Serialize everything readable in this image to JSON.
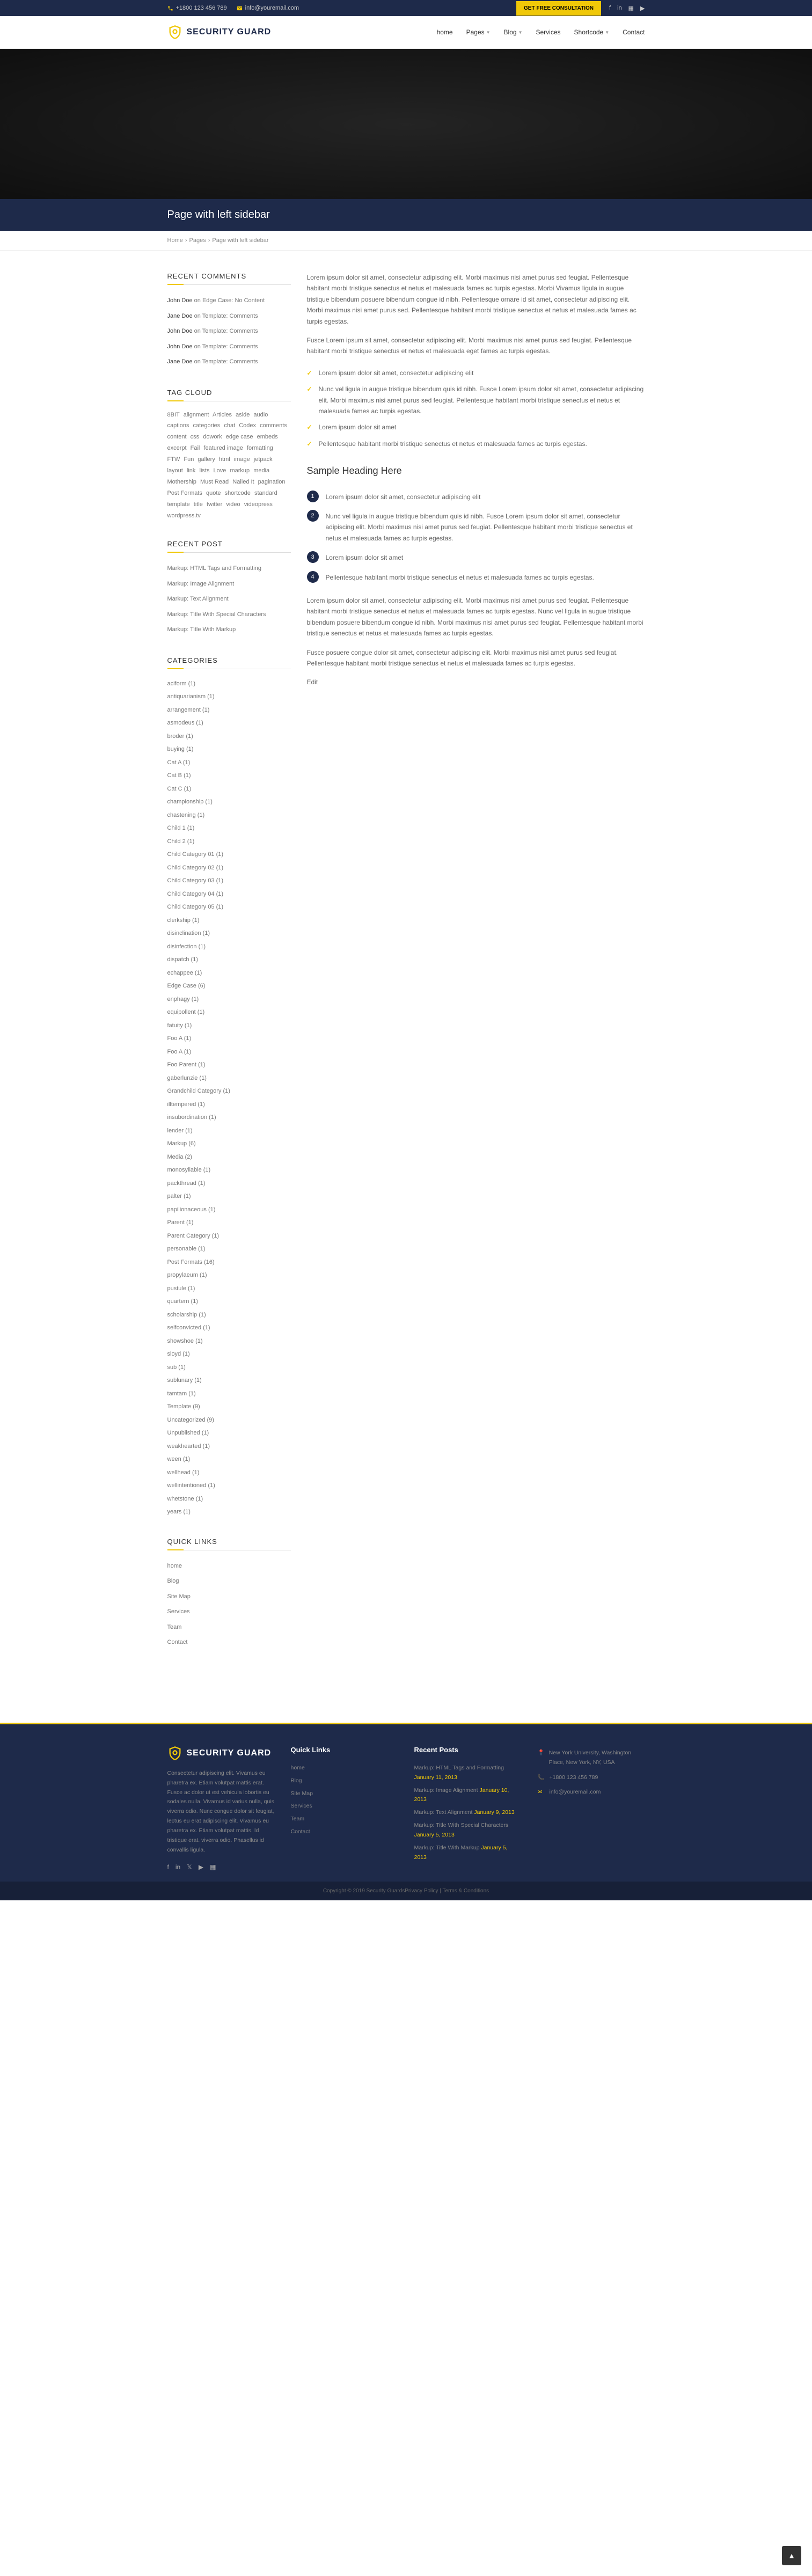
{
  "topbar": {
    "phone": "+1800 123 456 789",
    "email": "info@youremail.com",
    "cta": "GET FREE CONSULTATION"
  },
  "brand": "SECURITY GUARD",
  "nav": [
    "home",
    "Pages",
    "Blog",
    "Services",
    "Shortcode",
    "Contact"
  ],
  "page_title": "Page with left sidebar",
  "breadcrumb": [
    "Home",
    "Pages",
    "Page with left sidebar"
  ],
  "sidebar": {
    "recent_comments_title": "RECENT COMMENTS",
    "comments": [
      {
        "author": "John Doe",
        "on": "Edge Case: No Content"
      },
      {
        "author": "Jane Doe",
        "on": "Template: Comments"
      },
      {
        "author": "John Doe",
        "on": "Template: Comments"
      },
      {
        "author": "John Doe",
        "on": "Template: Comments"
      },
      {
        "author": "Jane Doe",
        "on": "Template: Comments"
      }
    ],
    "tag_title": "TAG CLOUD",
    "tags": [
      "8BIT",
      "alignment",
      "Articles",
      "aside",
      "audio",
      "captions",
      "categories",
      "chat",
      "Codex",
      "comments",
      "content",
      "css",
      "dowork",
      "edge case",
      "embeds",
      "excerpt",
      "Fail",
      "featured image",
      "formatting",
      "FTW",
      "Fun",
      "gallery",
      "html",
      "image",
      "jetpack",
      "layout",
      "link",
      "lists",
      "Love",
      "markup",
      "media",
      "Mothership",
      "Must Read",
      "Nailed It",
      "pagination",
      "Post Formats",
      "quote",
      "shortcode",
      "standard",
      "template",
      "title",
      "twitter",
      "video",
      "videopress",
      "wordpress.tv"
    ],
    "recent_title": "RECENT POST",
    "recent": [
      "Markup: HTML Tags and Formatting",
      "Markup: Image Alignment",
      "Markup: Text Alignment",
      "Markup: Title With Special Characters",
      "Markup: Title With Markup"
    ],
    "cat_title": "CATEGORIES",
    "categories": [
      {
        "n": "aciform",
        "c": 1
      },
      {
        "n": "antiquarianism",
        "c": 1
      },
      {
        "n": "arrangement",
        "c": 1
      },
      {
        "n": "asmodeus",
        "c": 1
      },
      {
        "n": "broder",
        "c": 1
      },
      {
        "n": "buying",
        "c": 1
      },
      {
        "n": "Cat A",
        "c": 1
      },
      {
        "n": "Cat B",
        "c": 1
      },
      {
        "n": "Cat C",
        "c": 1
      },
      {
        "n": "championship",
        "c": 1
      },
      {
        "n": "chastening",
        "c": 1
      },
      {
        "n": "Child 1",
        "c": 1
      },
      {
        "n": "Child 2",
        "c": 1
      },
      {
        "n": "Child Category 01",
        "c": 1
      },
      {
        "n": "Child Category 02",
        "c": 1
      },
      {
        "n": "Child Category 03",
        "c": 1
      },
      {
        "n": "Child Category 04",
        "c": 1
      },
      {
        "n": "Child Category 05",
        "c": 1
      },
      {
        "n": "clerkship",
        "c": 1
      },
      {
        "n": "disinclination",
        "c": 1
      },
      {
        "n": "disinfection",
        "c": 1
      },
      {
        "n": "dispatch",
        "c": 1
      },
      {
        "n": "echappee",
        "c": 1
      },
      {
        "n": "Edge Case",
        "c": 6
      },
      {
        "n": "enphagy",
        "c": 1
      },
      {
        "n": "equipollent",
        "c": 1
      },
      {
        "n": "fatuity",
        "c": 1
      },
      {
        "n": "Foo A",
        "c": 1
      },
      {
        "n": "Foo A",
        "c": 1
      },
      {
        "n": "Foo Parent",
        "c": 1
      },
      {
        "n": "gaberlunzie",
        "c": 1
      },
      {
        "n": "Grandchild Category",
        "c": 1
      },
      {
        "n": "illtempered",
        "c": 1
      },
      {
        "n": "insubordination",
        "c": 1
      },
      {
        "n": "lender",
        "c": 1
      },
      {
        "n": "Markup",
        "c": 6
      },
      {
        "n": "Media",
        "c": 2
      },
      {
        "n": "monosyllable",
        "c": 1
      },
      {
        "n": "packthread",
        "c": 1
      },
      {
        "n": "palter",
        "c": 1
      },
      {
        "n": "papilionaceous",
        "c": 1
      },
      {
        "n": "Parent",
        "c": 1
      },
      {
        "n": "Parent Category",
        "c": 1
      },
      {
        "n": "personable",
        "c": 1
      },
      {
        "n": "Post Formats",
        "c": 16
      },
      {
        "n": "propylaeum",
        "c": 1
      },
      {
        "n": "pustule",
        "c": 1
      },
      {
        "n": "quartern",
        "c": 1
      },
      {
        "n": "scholarship",
        "c": 1
      },
      {
        "n": "selfconvicted",
        "c": 1
      },
      {
        "n": "showshoe",
        "c": 1
      },
      {
        "n": "sloyd",
        "c": 1
      },
      {
        "n": "sub",
        "c": 1
      },
      {
        "n": "sublunary",
        "c": 1
      },
      {
        "n": "tamtam",
        "c": 1
      },
      {
        "n": "Template",
        "c": 9
      },
      {
        "n": "Uncategorized",
        "c": 9
      },
      {
        "n": "Unpublished",
        "c": 1
      },
      {
        "n": "weakhearted",
        "c": 1
      },
      {
        "n": "ween",
        "c": 1
      },
      {
        "n": "wellhead",
        "c": 1
      },
      {
        "n": "wellintentioned",
        "c": 1
      },
      {
        "n": "whetstone",
        "c": 1
      },
      {
        "n": "years",
        "c": 1
      }
    ],
    "quick_title": "QUICK LINKS",
    "quick": [
      "home",
      "Blog",
      "Site Map",
      "Services",
      "Team",
      "Contact"
    ]
  },
  "content": {
    "p1": "Lorem ipsum dolor sit amet, consectetur adipiscing elit. Morbi maximus nisi amet purus sed feugiat. Pellentesque habitant morbi tristique senectus et netus et malesuada fames ac turpis egestas. Morbi Vivamus ligula in augue tristique bibendum posuere bibendum congue id nibh. Pellentesque ornare id sit amet, consectetur adipiscing elit. Morbi maximus nisi amet purus sed. Pellentesque habitant morbi tristique senectus et netus et malesuada fames ac turpis egestas.",
    "p2": "Fusce Lorem ipsum sit amet, consectetur adipiscing elit. Morbi maximus nisi amet purus sed feugiat. Pellentesque habitant morbi tristique senectus et netus et malesuada eget fames ac turpis egestas.",
    "checks": [
      "Lorem ipsum dolor sit amet, consectetur adipiscing elit",
      "Nunc vel ligula in augue tristique bibendum quis id nibh. Fusce Lorem ipsum dolor sit amet, consectetur adipiscing elit. Morbi maximus nisi amet purus sed feugiat. Pellentesque habitant morbi tristique senectus et netus et malesuada fames ac turpis egestas.",
      "Lorem ipsum dolor sit amet",
      "Pellentesque habitant morbi tristique senectus et netus et malesuada fames ac turpis egestas."
    ],
    "h3": "Sample Heading Here",
    "nums": [
      "Lorem ipsum dolor sit amet, consectetur adipiscing elit",
      "Nunc vel ligula in augue tristique bibendum quis id nibh. Fusce Lorem ipsum dolor sit amet, consectetur adipiscing elit. Morbi maximus nisi amet purus sed feugiat. Pellentesque habitant morbi tristique senectus et netus et malesuada fames ac turpis egestas.",
      "Lorem ipsum dolor sit amet",
      "Pellentesque habitant morbi tristique senectus et netus et malesuada fames ac turpis egestas."
    ],
    "p3": "Lorem ipsum dolor sit amet, consectetur adipiscing elit. Morbi maximus nisi amet purus sed feugiat. Pellentesque habitant morbi tristique senectus et netus et malesuada fames ac turpis egestas. Nunc vel ligula in augue tristique bibendum posuere bibendum congue id nibh. Morbi maximus nisi amet purus sed feugiat. Pellentesque habitant morbi tristique senectus et netus et malesuada fames ac turpis egestas.",
    "p4": "Fusce posuere congue dolor sit amet, consectetur adipiscing elit. Morbi maximus nisi amet purus sed feugiat. Pellentesque habitant morbi tristique senectus et netus et malesuada fames ac turpis egestas.",
    "edit": "Edit"
  },
  "footer": {
    "about": "Consectetur adipiscing elit. Vivamus eu pharetra ex. Etiam volutpat mattis erat. Fusce ac dolor ut est vehicula lobortis eu sodales nulla. Vivamus id varius nulla, quis viverra odio. Nunc congue dolor sit feugiat, lectus eu erat adipiscing elit. Vivamus eu pharetra ex. Etiam volutpat mattis. Id tristique erat. viverra odio. Phasellus id convallis ligula.",
    "quick_title": "Quick Links",
    "quick": [
      "home",
      "Blog",
      "Site Map",
      "Services",
      "Team",
      "Contact"
    ],
    "recent_title": "Recent Posts",
    "recent": [
      {
        "t": "Markup: HTML Tags and Formatting",
        "d": "January 11, 2013"
      },
      {
        "t": "Markup: Image Alignment",
        "d": "January 10, 2013"
      },
      {
        "t": "Markup: Text Alignment",
        "d": "January 9, 2013"
      },
      {
        "t": "Markup: Title With Special Characters",
        "d": "January 5, 2013"
      },
      {
        "t": "Markup: Title With Markup",
        "d": "January 5, 2013"
      }
    ],
    "contact": [
      {
        "ico": "📍",
        "t": "New York University, Washington Place, New York, NY, USA"
      },
      {
        "ico": "📞",
        "t": "+1800 123 456 789"
      },
      {
        "ico": "✉",
        "t": "info@youremail.com"
      }
    ],
    "copyright": "Copyright © 2019 Security Guards",
    "legal": "Privacy Policy  |  Terms & Conditions"
  }
}
